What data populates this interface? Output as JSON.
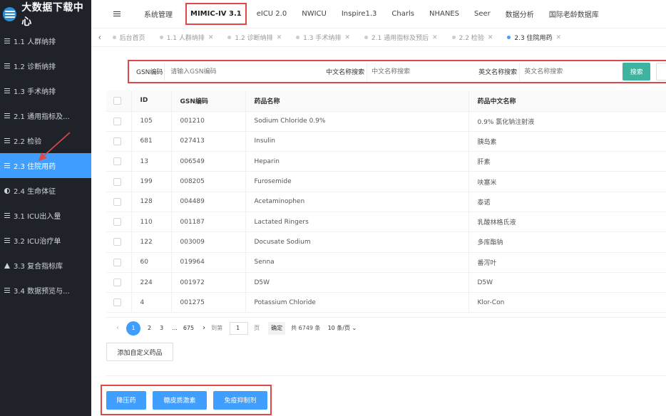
{
  "app": {
    "title": "大数据下载中心"
  },
  "sidebar": {
    "items": [
      {
        "label": "1.1 人群纳排",
        "icon": "list-icon"
      },
      {
        "label": "1.2 诊断纳排",
        "icon": "list-icon"
      },
      {
        "label": "1.3 手术纳排",
        "icon": "list-icon"
      },
      {
        "label": "2.1 通用指标及...",
        "icon": "list-icon"
      },
      {
        "label": "2.2 检验",
        "icon": "list-icon"
      },
      {
        "label": "2.3 住院用药",
        "icon": "list-icon",
        "active": true
      },
      {
        "label": "2.4 生命体征",
        "icon": "half-circle-icon"
      },
      {
        "label": "3.1 ICU出入量",
        "icon": "list-icon"
      },
      {
        "label": "3.2 ICU治疗单",
        "icon": "list-icon"
      },
      {
        "label": "3.3 复合指标库",
        "icon": "flask-icon"
      },
      {
        "label": "3.4 数据预览与...",
        "icon": "list-icon"
      }
    ]
  },
  "topnav": {
    "tabs": [
      "系统管理",
      "MIMIC-IV 3.1",
      "eICU 2.0",
      "NWICU",
      "Inspire1.3",
      "Charls",
      "NHANES",
      "Seer",
      "数据分析",
      "国际老龄数据库"
    ],
    "active": "MIMIC-IV 3.1"
  },
  "page_tabs": [
    {
      "label": "后台首页"
    },
    {
      "label": "1.1 人群纳排"
    },
    {
      "label": "1.2 诊断纳排"
    },
    {
      "label": "1.3 手术纳排"
    },
    {
      "label": "2.1 通用指标及预后"
    },
    {
      "label": "2.2 检验"
    },
    {
      "label": "2.3 住院用药"
    }
  ],
  "search": {
    "gsn_label": "GSN编码",
    "gsn_placeholder": "请输入GSN编码",
    "cn_label": "中文名称搜索",
    "cn_placeholder": "中文名称搜索",
    "en_label": "英文名称搜索",
    "en_placeholder": "英文名称搜索",
    "button": "搜索"
  },
  "table": {
    "headers": [
      "ID",
      "GSN编码",
      "药品名称",
      "药品中文名称"
    ],
    "rows": [
      [
        "105",
        "001210",
        "Sodium Chloride 0.9%",
        "0.9% 氯化钠注射液"
      ],
      [
        "681",
        "027413",
        "Insulin",
        "胰岛素"
      ],
      [
        "13",
        "006549",
        "Heparin",
        "肝素"
      ],
      [
        "199",
        "008205",
        "Furosemide",
        "呋塞米"
      ],
      [
        "128",
        "004489",
        "Acetaminophen",
        "泰诺"
      ],
      [
        "110",
        "001187",
        "Lactated Ringers",
        "乳酸林格氏液"
      ],
      [
        "122",
        "003009",
        "Docusate Sodium",
        "多库酯钠"
      ],
      [
        "60",
        "019964",
        "Senna",
        "番泻叶"
      ],
      [
        "224",
        "001972",
        "D5W",
        "D5W"
      ],
      [
        "4",
        "001275",
        "Potassium Chloride",
        "Klor-Con"
      ]
    ]
  },
  "pagination": {
    "pages": [
      "1",
      "2",
      "3",
      "...",
      "675"
    ],
    "current": "1",
    "jump_label": "到第",
    "jump_value": "1",
    "page_suffix": "页",
    "confirm": "确定",
    "total": "共 6749 条",
    "page_size": "10 条/页"
  },
  "actions": {
    "add_custom": "添加自定义药品",
    "buttons": [
      "降压药",
      "糖皮质激素",
      "免疫抑制剂"
    ]
  },
  "colors": {
    "sidebar_bg": "#20222A",
    "primary": "#409EFF",
    "search_button": "#3db3a0",
    "highlight": "#e04848"
  }
}
